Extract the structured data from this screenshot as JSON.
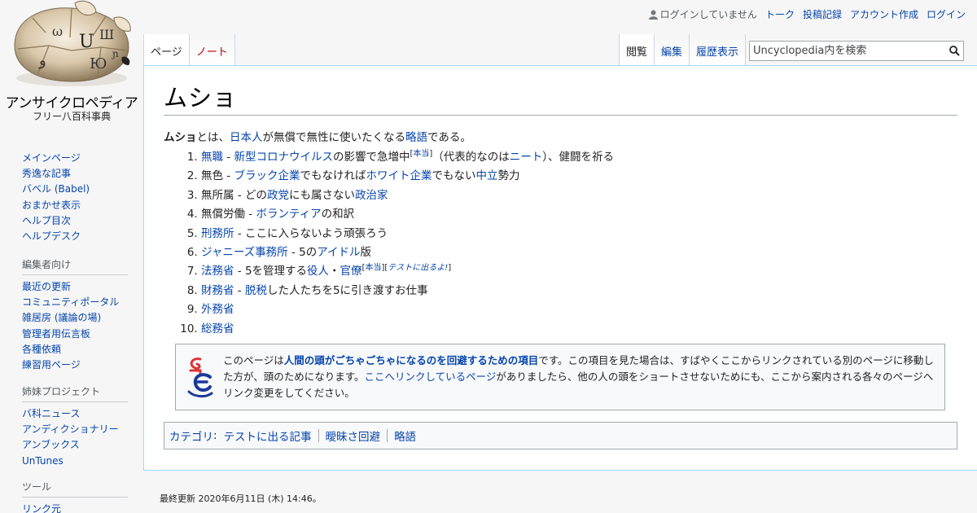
{
  "site": {
    "title": "アンサイクロペディア",
    "subtitle": "フリー八百科事典"
  },
  "personal_tools": {
    "not_logged_in": "ログインしていません",
    "talk": "トーク",
    "contributions": "投稿記録",
    "create_account": "アカウント作成",
    "login": "ログイン"
  },
  "tabs": {
    "page": "ページ",
    "note": "ノート",
    "read": "閲覧",
    "edit": "編集",
    "history": "履歴表示"
  },
  "search": {
    "placeholder": "Uncyclopedia内を検索"
  },
  "article": {
    "title": "ムショ",
    "lead": {
      "term": "ムショ",
      "t1": "とは、",
      "l1": "日本人",
      "t2": "が無償で無性に使いたくなる",
      "l2": "略語",
      "t3": "である。"
    },
    "items": [
      {
        "a": "無職",
        "b": " - ",
        "c": "新型コロナウイルス",
        "d": "の影響で急増中",
        "e": "本当",
        "f": "（代表的なのは",
        "g": "ニート",
        "h": "）、健闘を祈る"
      },
      {
        "a": "無色 - ",
        "b": "ブラック企業",
        "c": "でもなければ",
        "d": "ホワイト企業",
        "e": "でもない",
        "f": "中立",
        "g": "勢力"
      },
      {
        "a": "無所属 - どの",
        "b": "政党",
        "c": "にも属さない",
        "d": "政治家"
      },
      {
        "a": "無償労働 - ",
        "b": "ボランティア",
        "c": "の和訳"
      },
      {
        "a": "刑務所",
        "b": " - ここに入らないよう頑張ろう"
      },
      {
        "a": "ジャニーズ事務所",
        "b": " - 5の",
        "c": "アイドル",
        "d": "版"
      },
      {
        "a": "法務省",
        "b": " - 5を管理する",
        "c": "役人",
        "d": "・",
        "e": "官僚",
        "f": "本当",
        "g": "テストに出るよ!"
      },
      {
        "a": "財務省",
        "b": " - ",
        "c": "脱税",
        "d": "した人たちを5に引き渡すお仕事"
      },
      {
        "a": "外務省"
      },
      {
        "a": "総務省"
      }
    ],
    "notice": {
      "t1": "このページは",
      "l1": "人間の頭がごちゃごちゃになるのを回避するための項目",
      "t2": "です。この項目を見た場合は、すばやくここからリンクされている別のページに移動した方が、頭のためになります。",
      "l2": "ここへリンクしているページ",
      "t3": "がありましたら、他の人の頭をショートさせないためにも、ここから案内される各々のページへリンク変更をしてください。"
    },
    "categories": {
      "label": "カテゴリ",
      "colon": ":",
      "items": [
        "テストに出る記事",
        "曖昧さ回避",
        "略語"
      ]
    }
  },
  "sidebar": {
    "navigation": [
      "メインページ",
      "秀逸な記事",
      "バベル (Babel)",
      "おまかせ表示",
      "ヘルプ目次",
      "ヘルプデスク"
    ],
    "editors": {
      "heading": "編集者向け",
      "items": [
        "最近の更新",
        "コミュニティポータル",
        "雑居房 (議論の場)",
        "管理者用伝言板",
        "各種依頼",
        "練習用ページ"
      ]
    },
    "sister": {
      "heading": "姉妹プロジェクト",
      "items": [
        "バ科ニュース",
        "アンディクショナリー",
        "アンブックス",
        "UnTunes"
      ]
    },
    "tools": {
      "heading": "ツール",
      "items": [
        "リンク元"
      ]
    }
  },
  "footer": {
    "last_modified": "最終更新 2020年6月11日 (木) 14:46。"
  }
}
